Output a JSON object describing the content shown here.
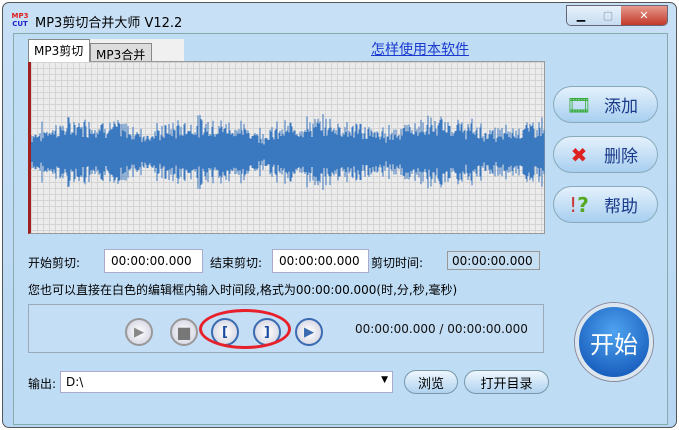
{
  "window": {
    "title": "MP3剪切合并大师 V12.2",
    "logo_top": "MP3",
    "logo_bottom": "CUT"
  },
  "tabs": [
    {
      "label": "MP3剪切"
    },
    {
      "label": "MP3合并"
    }
  ],
  "help_link": "怎样使用本软件",
  "side_buttons": [
    {
      "label": "添加",
      "icon": "film-add-icon"
    },
    {
      "label": "删除",
      "icon": "red-x-icon"
    },
    {
      "label": "帮助",
      "icon": "help-icon"
    }
  ],
  "fields": {
    "start_label": "开始剪切:",
    "start_value": "00:00:00.000",
    "end_label": "结束剪切:",
    "end_value": "00:00:00.000",
    "duration_label": "剪切时间:",
    "duration_value": "00:00:00.000"
  },
  "hint": "您也可以直接在白色的编辑框内输入时间段,格式为00:00:00.000(时,分,秒,毫秒)",
  "player": {
    "time": "00:00:00.000 / 00:00:00.000",
    "play": "▶",
    "stop": "■",
    "mark_start": "[",
    "mark_end": "]",
    "play_selection": "▶"
  },
  "start_button": "开始",
  "output": {
    "label": "输出:",
    "value": "D:\\",
    "browse": "浏览",
    "open_dir": "打开目录"
  },
  "colors": {
    "accent": "#1a5fc8",
    "highlight": "#e8202a"
  }
}
